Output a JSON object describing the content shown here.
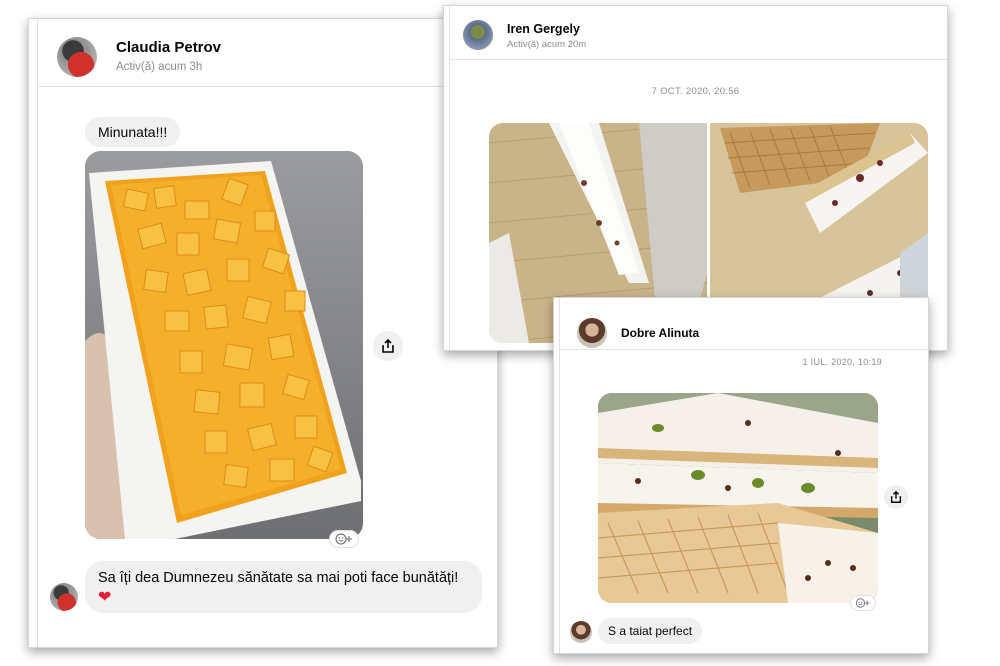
{
  "conversations": [
    {
      "contact_name": "Claudia Petrov",
      "status": "Activ(ă) acum 3h",
      "messages": [
        {
          "type": "text",
          "text": "Minunata!!!"
        },
        {
          "type": "photo",
          "icon": "share-icon",
          "reaction_icon": "add-reaction-icon"
        },
        {
          "type": "text",
          "text": "Sa îți dea Dumnezeu sănătate sa mai poti face bunătăți!",
          "emoji": "❤"
        }
      ]
    },
    {
      "contact_name": "Iren Gergely",
      "status": "Activ(ă) acum 20m",
      "timestamp": "7 OCT. 2020, 20:56",
      "messages": [
        {
          "type": "photo"
        },
        {
          "type": "photo"
        }
      ]
    },
    {
      "contact_name": "Dobre Alinuta",
      "timestamp": "1 IUL. 2020, 10:19",
      "messages": [
        {
          "type": "photo",
          "icon": "share-icon",
          "reaction_icon": "add-reaction-icon"
        },
        {
          "type": "text",
          "text": "S a taiat perfect"
        }
      ]
    }
  ],
  "colors": {
    "bubble": "#f0f0f0",
    "secondary_text": "#8a8d91",
    "heart": "#e41e3f"
  }
}
